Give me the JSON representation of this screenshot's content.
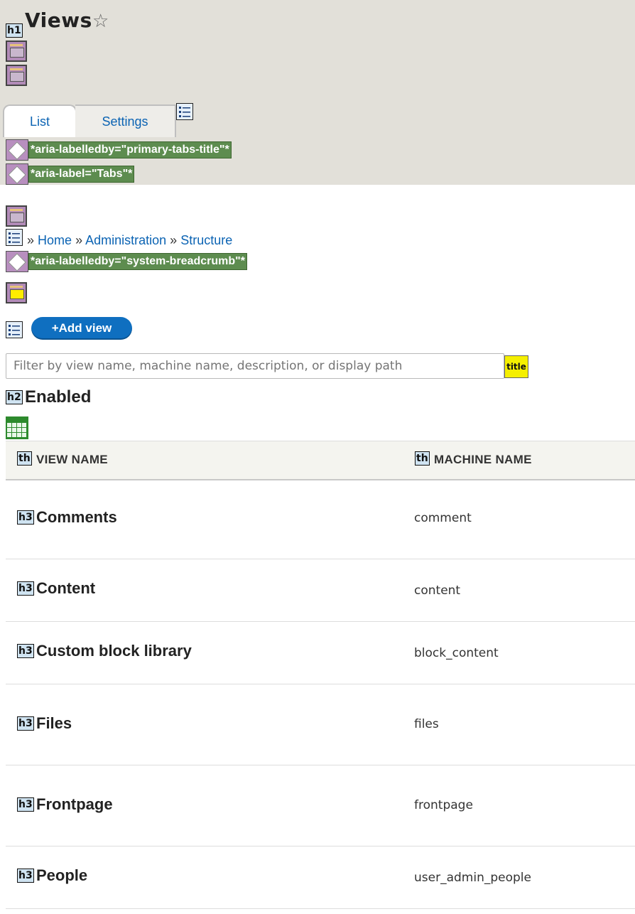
{
  "page": {
    "title": "Views",
    "h1_badge": "h1",
    "h2_badge": "h2",
    "h3_badge": "h3",
    "th_badge": "th"
  },
  "tabs": [
    {
      "label": "List",
      "active": true
    },
    {
      "label": "Settings",
      "active": false
    }
  ],
  "aria": {
    "tabs_title": "*aria-labelledby=\"primary-tabs-title\"*",
    "tabs_label": "*aria-label=\"Tabs\"*",
    "breadcrumb_title": "*aria-labelledby=\"system-breadcrumb\"*"
  },
  "breadcrumb": {
    "separator": "»",
    "items": [
      "Home",
      "Administration",
      "Structure"
    ]
  },
  "actions": {
    "add_view": "+Add view"
  },
  "filter": {
    "placeholder": "Filter by view name, machine name, description, or display path",
    "title_tag": "title"
  },
  "section": {
    "heading": "Enabled"
  },
  "table": {
    "headers": [
      "VIEW NAME",
      "MACHINE NAME"
    ],
    "rows": [
      {
        "name": "Comments",
        "machine": "comment"
      },
      {
        "name": "Content",
        "machine": "content"
      },
      {
        "name": "Custom block library",
        "machine": "block_content"
      },
      {
        "name": "Files",
        "machine": "files"
      },
      {
        "name": "Frontpage",
        "machine": "frontpage"
      },
      {
        "name": "People",
        "machine": "user_admin_people"
      }
    ]
  }
}
